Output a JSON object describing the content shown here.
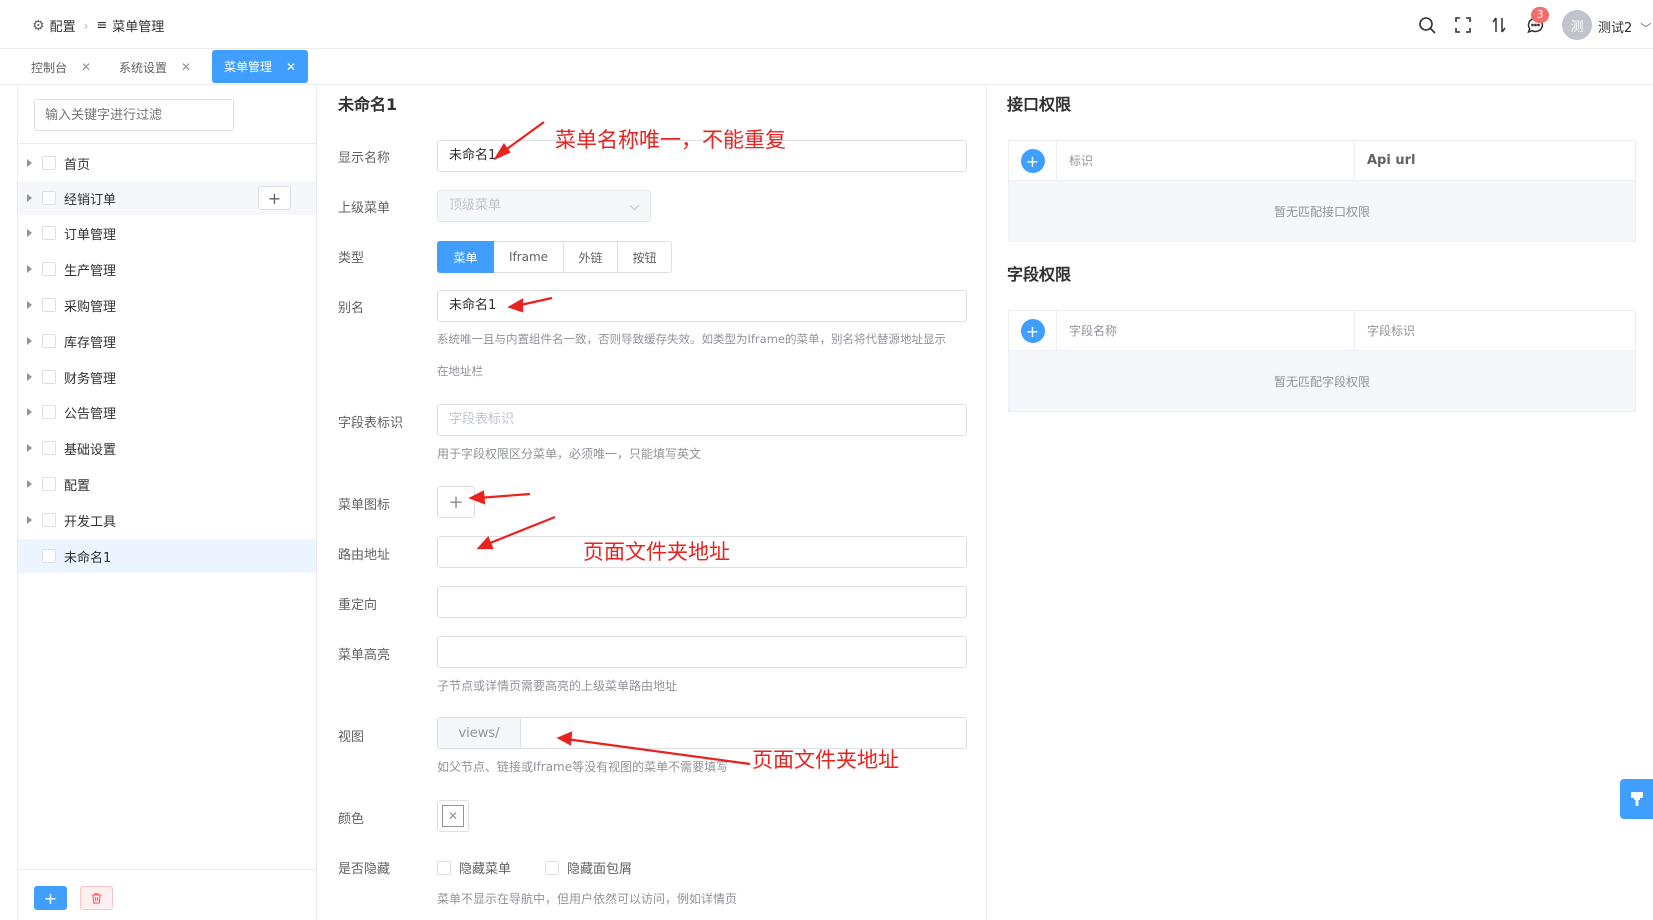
{
  "breadcrumb": {
    "root": "配置",
    "current": "菜单管理"
  },
  "header": {
    "notification_count": "3",
    "avatar_text": "测",
    "username": "测试2"
  },
  "tabs": [
    {
      "label": "控制台"
    },
    {
      "label": "系统设置"
    },
    {
      "label": "菜单管理"
    }
  ],
  "tree": {
    "filter_placeholder": "输入关键字进行过滤",
    "items": [
      {
        "label": "首页"
      },
      {
        "label": "经销订单"
      },
      {
        "label": "订单管理"
      },
      {
        "label": "生产管理"
      },
      {
        "label": "采购管理"
      },
      {
        "label": "库存管理"
      },
      {
        "label": "财务管理"
      },
      {
        "label": "公告管理"
      },
      {
        "label": "基础设置"
      },
      {
        "label": "配置"
      },
      {
        "label": "开发工具"
      },
      {
        "label": "未命名1"
      }
    ]
  },
  "form": {
    "title": "未命名1",
    "labels": {
      "display_name": "显示名称",
      "parent": "上级菜单",
      "type": "类型",
      "alias": "别名",
      "field_table": "字段表标识",
      "icon": "菜单图标",
      "route": "路由地址",
      "redirect": "重定向",
      "highlight": "菜单高亮",
      "view": "视图",
      "color": "颜色",
      "hidden": "是否隐藏"
    },
    "display_name_value": "未命名1",
    "parent_placeholder": "顶级菜单",
    "type_options": [
      "菜单",
      "Iframe",
      "外链",
      "按钮"
    ],
    "alias_value": "未命名1",
    "alias_help_1": "系统唯一且与内置组件名一致，否则导致缓存失效。如类型为Iframe的菜单，别名将代替源地址显示",
    "alias_help_2": "在地址栏",
    "field_table_placeholder": "字段表标识",
    "field_table_help": "用于字段权限区分菜单，必须唯一，只能填写英文",
    "highlight_help": "子节点或详情页需要高亮的上级菜单路由地址",
    "view_prefix": "views/",
    "view_help": "如父节点、链接或Iframe等没有视图的菜单不需要填写",
    "hide_menu": "隐藏菜单",
    "hide_breadcrumb": "隐藏面包屑",
    "hidden_help": "菜单不显示在导航中，但用户依然可以访问，例如详情页"
  },
  "annotations": {
    "name_unique": "菜单名称唯一，不能重复",
    "route_note": "页面文件夹地址",
    "view_note": "页面文件夹地址",
    "color": "#e8231f"
  },
  "api_perm": {
    "title": "接口权限",
    "col_id": "标识",
    "col_url": "Api url",
    "empty": "暂无匹配接口权限"
  },
  "field_perm": {
    "title": "字段权限",
    "col_name": "字段名称",
    "col_id": "字段标识",
    "empty": "暂无匹配字段权限"
  },
  "accent_color": "#409eff"
}
